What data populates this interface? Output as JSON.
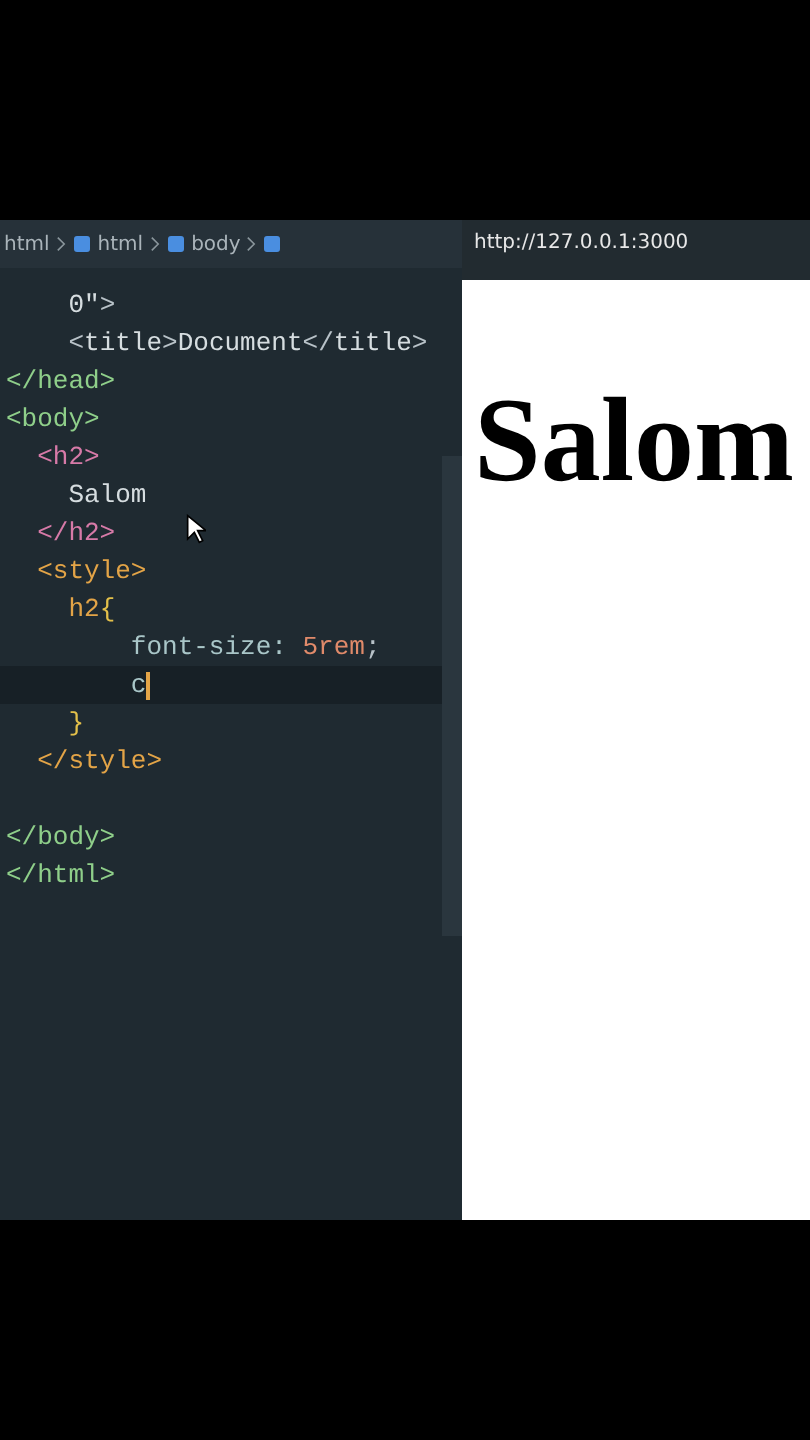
{
  "breadcrumbs": [
    "html",
    "html",
    "body"
  ],
  "editor": {
    "lines": [
      {
        "active": false,
        "tokens": [
          {
            "kind": "text",
            "text": "    0\""
          },
          {
            "kind": "punct",
            "text": ">"
          }
        ]
      },
      {
        "active": false,
        "tokens": [
          {
            "kind": "punct",
            "text": "    <"
          },
          {
            "kind": "meta",
            "text": "title"
          },
          {
            "kind": "punct",
            "text": ">"
          },
          {
            "kind": "text",
            "text": "Document"
          },
          {
            "kind": "punct",
            "text": "</"
          },
          {
            "kind": "meta",
            "text": "title"
          },
          {
            "kind": "punct",
            "text": ">"
          }
        ]
      },
      {
        "active": false,
        "tokens": [
          {
            "kind": "structure",
            "text": "</head>"
          }
        ]
      },
      {
        "active": false,
        "tokens": [
          {
            "kind": "structure",
            "text": "<body>"
          }
        ]
      },
      {
        "active": false,
        "tokens": [
          {
            "kind": "heading",
            "text": "  <h2>"
          }
        ]
      },
      {
        "active": false,
        "tokens": [
          {
            "kind": "text",
            "text": "    Salom"
          }
        ]
      },
      {
        "active": false,
        "tokens": [
          {
            "kind": "heading",
            "text": "  </h2>"
          }
        ]
      },
      {
        "active": false,
        "tokens": [
          {
            "kind": "style",
            "text": "  <style>"
          }
        ]
      },
      {
        "active": false,
        "tokens": [
          {
            "kind": "style",
            "text": "    h2"
          },
          {
            "kind": "brace",
            "text": "{"
          }
        ]
      },
      {
        "active": false,
        "tokens": [
          {
            "kind": "property",
            "text": "        font-size: "
          },
          {
            "kind": "number",
            "text": "5rem"
          },
          {
            "kind": "punct",
            "text": ";"
          }
        ]
      },
      {
        "active": true,
        "tokens": [
          {
            "kind": "property",
            "text": "        c"
          }
        ]
      },
      {
        "active": false,
        "tokens": [
          {
            "kind": "brace",
            "text": "    }"
          }
        ]
      },
      {
        "active": false,
        "tokens": [
          {
            "kind": "style",
            "text": "  </style>"
          }
        ]
      },
      {
        "blank": true
      },
      {
        "active": false,
        "tokens": [
          {
            "kind": "structure",
            "text": "</body>"
          }
        ]
      },
      {
        "active": false,
        "tokens": [
          {
            "kind": "structure",
            "text": "</html>"
          }
        ]
      }
    ]
  },
  "preview": {
    "url": "http://127.0.0.1:3000",
    "heading": "Salom"
  }
}
